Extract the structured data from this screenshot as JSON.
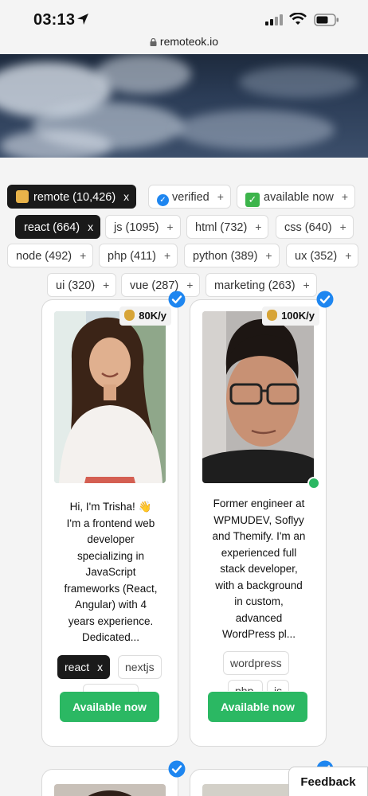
{
  "status_bar": {
    "time": "03:13",
    "url": "remoteok.io"
  },
  "filters": {
    "row1": [
      {
        "label": "remote (10,426)",
        "action": "x",
        "style": "dark",
        "icon": "worker-emoji-icon"
      },
      {
        "label": "verified",
        "action": "+",
        "icon": "verified-badge-icon"
      },
      {
        "label": "available now",
        "action": "+",
        "icon": "green-check-icon"
      }
    ],
    "row2": [
      {
        "label": "react (664)",
        "action": "x",
        "style": "dark"
      },
      {
        "label": "js (1095)",
        "action": "+"
      },
      {
        "label": "html (732)",
        "action": "+"
      },
      {
        "label": "css (640)",
        "action": "+"
      }
    ],
    "row3": [
      {
        "label": "node (492)",
        "action": "+"
      },
      {
        "label": "php (411)",
        "action": "+"
      },
      {
        "label": "python (389)",
        "action": "+"
      },
      {
        "label": "ux (352)",
        "action": "+"
      }
    ],
    "row4": [
      {
        "label": "ui (320)",
        "action": "+"
      },
      {
        "label": "vue (287)",
        "action": "+"
      },
      {
        "label": "marketing (263)",
        "action": "+"
      }
    ]
  },
  "cards": [
    {
      "salary": "80K/y",
      "bio": [
        "Hi, I'm Trisha! 👋",
        "I'm a frontend web",
        "developer",
        "specializing in",
        "JavaScript",
        "frameworks (React,",
        "Angular) with 4",
        "years experience.",
        "Dedicated..."
      ],
      "skills": [
        {
          "label": "react",
          "action": "x",
          "style": "dark"
        },
        {
          "label": "nextjs"
        }
      ],
      "cta": "Available now"
    },
    {
      "salary": "100K/y",
      "bio": [
        "Former engineer at",
        "WPMUDEV, Soflyy",
        "and Themify. I'm an",
        "experienced full",
        "stack developer,",
        "with a background",
        "in custom,",
        "advanced",
        "WordPress pl..."
      ],
      "skills": [
        {
          "label": "wordpress"
        },
        {
          "label": "php"
        },
        {
          "label": "js"
        }
      ],
      "cta": "Available now"
    }
  ],
  "bottom_cards": [
    {
      "salary": ""
    },
    {
      "salary": "$"
    }
  ],
  "feedback_label": "Feedback",
  "colors": {
    "accent_green": "#2bb863",
    "verified_blue": "#1e86f0",
    "dark_tag": "#1a1a1a"
  }
}
